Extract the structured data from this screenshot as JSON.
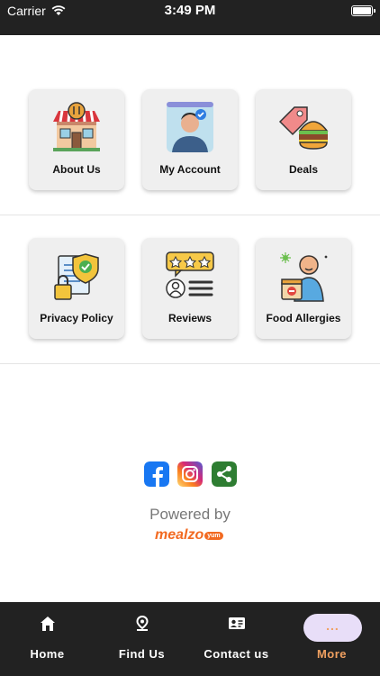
{
  "status_bar": {
    "carrier": "Carrier",
    "time": "3:49 PM"
  },
  "grid": {
    "row1": [
      {
        "label": "About Us",
        "icon": "restaurant-icon"
      },
      {
        "label": "My Account",
        "icon": "user-profile-icon"
      },
      {
        "label": "Deals",
        "icon": "burger-tag-icon"
      }
    ],
    "row2": [
      {
        "label": "Privacy Policy",
        "icon": "privacy-document-icon"
      },
      {
        "label": "Reviews",
        "icon": "star-review-icon"
      },
      {
        "label": "Food Allergies",
        "icon": "allergy-person-icon"
      }
    ]
  },
  "social": [
    {
      "name": "facebook-icon",
      "color": "#1877f2"
    },
    {
      "name": "instagram-icon",
      "color": "#e1306c"
    },
    {
      "name": "share-icon",
      "color": "#2e7d32"
    }
  ],
  "footer": {
    "powered_by": "Powered by",
    "brand": "mealzo",
    "brand_badge": "yum"
  },
  "tabs": [
    {
      "label": "Home",
      "icon": "home-icon"
    },
    {
      "label": "Find Us",
      "icon": "location-pin-icon"
    },
    {
      "label": "Contact us",
      "icon": "contact-card-icon"
    },
    {
      "label": "More",
      "icon": "more-dots-icon",
      "dots": "...",
      "active": true,
      "active_color": "#f0a060"
    }
  ],
  "colors": {
    "dark_bar": "#222222",
    "tile_bg": "#efefef",
    "accent": "#f26a21",
    "active_pill": "#e8def8"
  }
}
